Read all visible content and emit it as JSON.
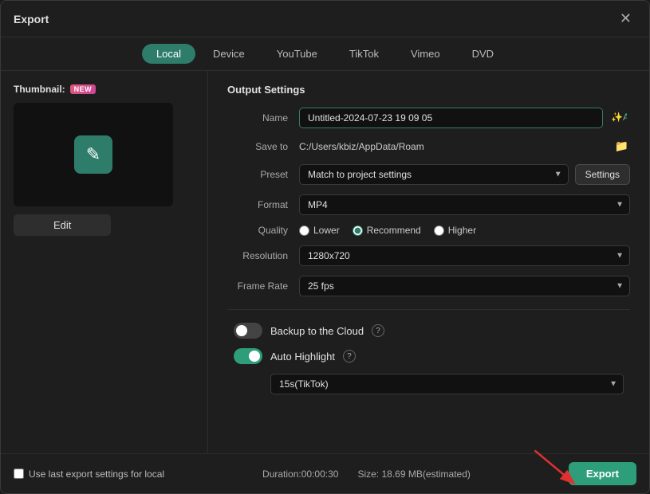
{
  "window": {
    "title": "Export"
  },
  "tabs": [
    {
      "label": "Local",
      "active": true
    },
    {
      "label": "Device",
      "active": false
    },
    {
      "label": "YouTube",
      "active": false
    },
    {
      "label": "TikTok",
      "active": false
    },
    {
      "label": "Vimeo",
      "active": false
    },
    {
      "label": "DVD",
      "active": false
    }
  ],
  "thumbnail": {
    "label": "Thumbnail:",
    "badge": "NEW",
    "edit_label": "Edit"
  },
  "output": {
    "section_title": "Output Settings",
    "name_label": "Name",
    "name_value": "Untitled-2024-07-23 19 09 05",
    "save_to_label": "Save to",
    "save_to_value": "C:/Users/kbiz/AppData/Roam",
    "preset_label": "Preset",
    "preset_value": "Match to project settings",
    "settings_label": "Settings",
    "format_label": "Format",
    "format_value": "MP4",
    "quality_label": "Quality",
    "quality_lower": "Lower",
    "quality_recommend": "Recommend",
    "quality_higher": "Higher",
    "resolution_label": "Resolution",
    "resolution_value": "1280x720",
    "frame_rate_label": "Frame Rate",
    "frame_rate_value": "25 fps",
    "backup_label": "Backup to the Cloud",
    "auto_highlight_label": "Auto Highlight",
    "tiktok_duration_value": "15s(TikTok)"
  },
  "bottom": {
    "checkbox_label": "Use last export settings for local",
    "duration_label": "Duration:",
    "duration_value": "00:00:30",
    "size_label": "Size:",
    "size_value": "18.69 MB(estimated)",
    "export_label": "Export"
  }
}
